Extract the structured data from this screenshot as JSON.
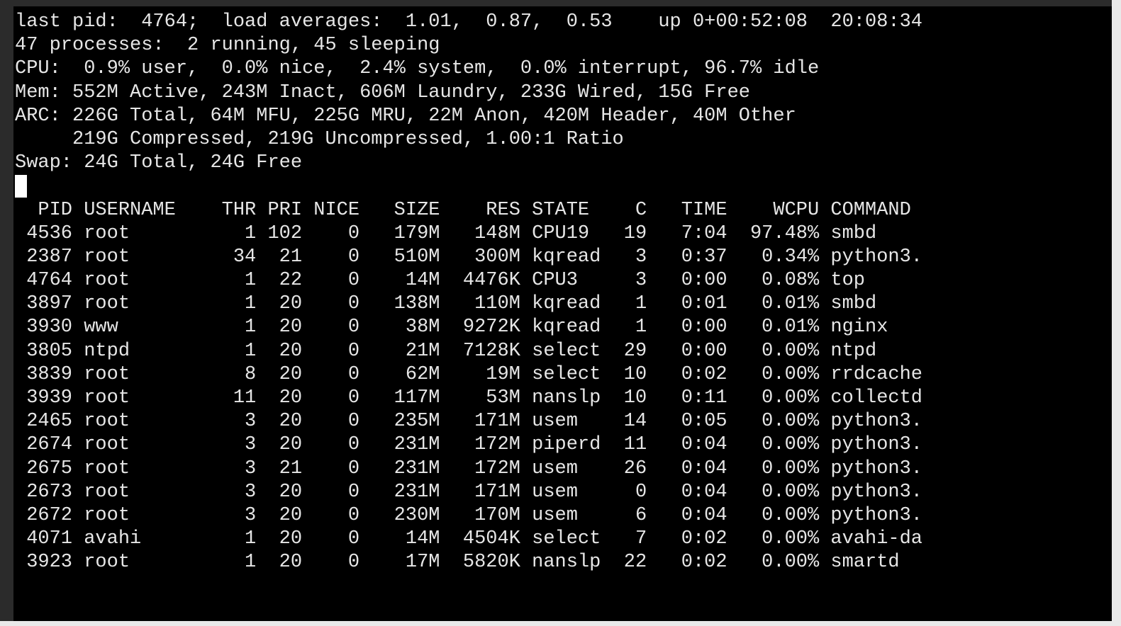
{
  "terminal": {
    "header_lines": [
      "last pid:  4764;  load averages:  1.01,  0.87,  0.53    up 0+00:52:08  20:08:34",
      "47 processes:  2 running, 45 sleeping",
      "CPU:  0.9% user,  0.0% nice,  2.4% system,  0.0% interrupt, 96.7% idle",
      "Mem: 552M Active, 243M Inact, 606M Laundry, 233G Wired, 15G Free",
      "ARC: 226G Total, 64M MFU, 225G MRU, 22M Anon, 420M Header, 40M Other",
      "     219G Compressed, 219G Uncompressed, 1.00:1 Ratio",
      "Swap: 24G Total, 24G Free"
    ],
    "table_header": "  PID USERNAME    THR PRI NICE   SIZE    RES STATE    C   TIME    WCPU COMMAND",
    "process_rows": [
      " 4536 root          1 102    0   179M   148M CPU19   19   7:04  97.48% smbd",
      " 2387 root         34  21    0   510M   300M kqread   3   0:37   0.34% python3.",
      " 4764 root          1  22    0    14M  4476K CPU3     3   0:00   0.08% top",
      " 3897 root          1  20    0   138M   110M kqread   1   0:01   0.01% smbd",
      " 3930 www           1  20    0    38M  9272K kqread   1   0:00   0.01% nginx",
      " 3805 ntpd          1  20    0    21M  7128K select  29   0:00   0.00% ntpd",
      " 3839 root          8  20    0    62M    19M select  10   0:02   0.00% rrdcache",
      " 3939 root         11  20    0   117M    53M nanslp  10   0:11   0.00% collectd",
      " 2465 root          3  20    0   235M   171M usem    14   0:05   0.00% python3.",
      " 2674 root          3  20    0   231M   172M piperd  11   0:04   0.00% python3.",
      " 2675 root          3  21    0   231M   172M usem    26   0:04   0.00% python3.",
      " 2673 root          3  20    0   231M   171M usem     0   0:04   0.00% python3.",
      " 2672 root          3  20    0   230M   170M usem     6   0:04   0.00% python3.",
      " 4071 avahi         1  20    0    14M  4504K select   7   0:02   0.00% avahi-da",
      " 3923 root          1  20    0    17M  5820K nanslp  22   0:02   0.00% smartd"
    ]
  }
}
